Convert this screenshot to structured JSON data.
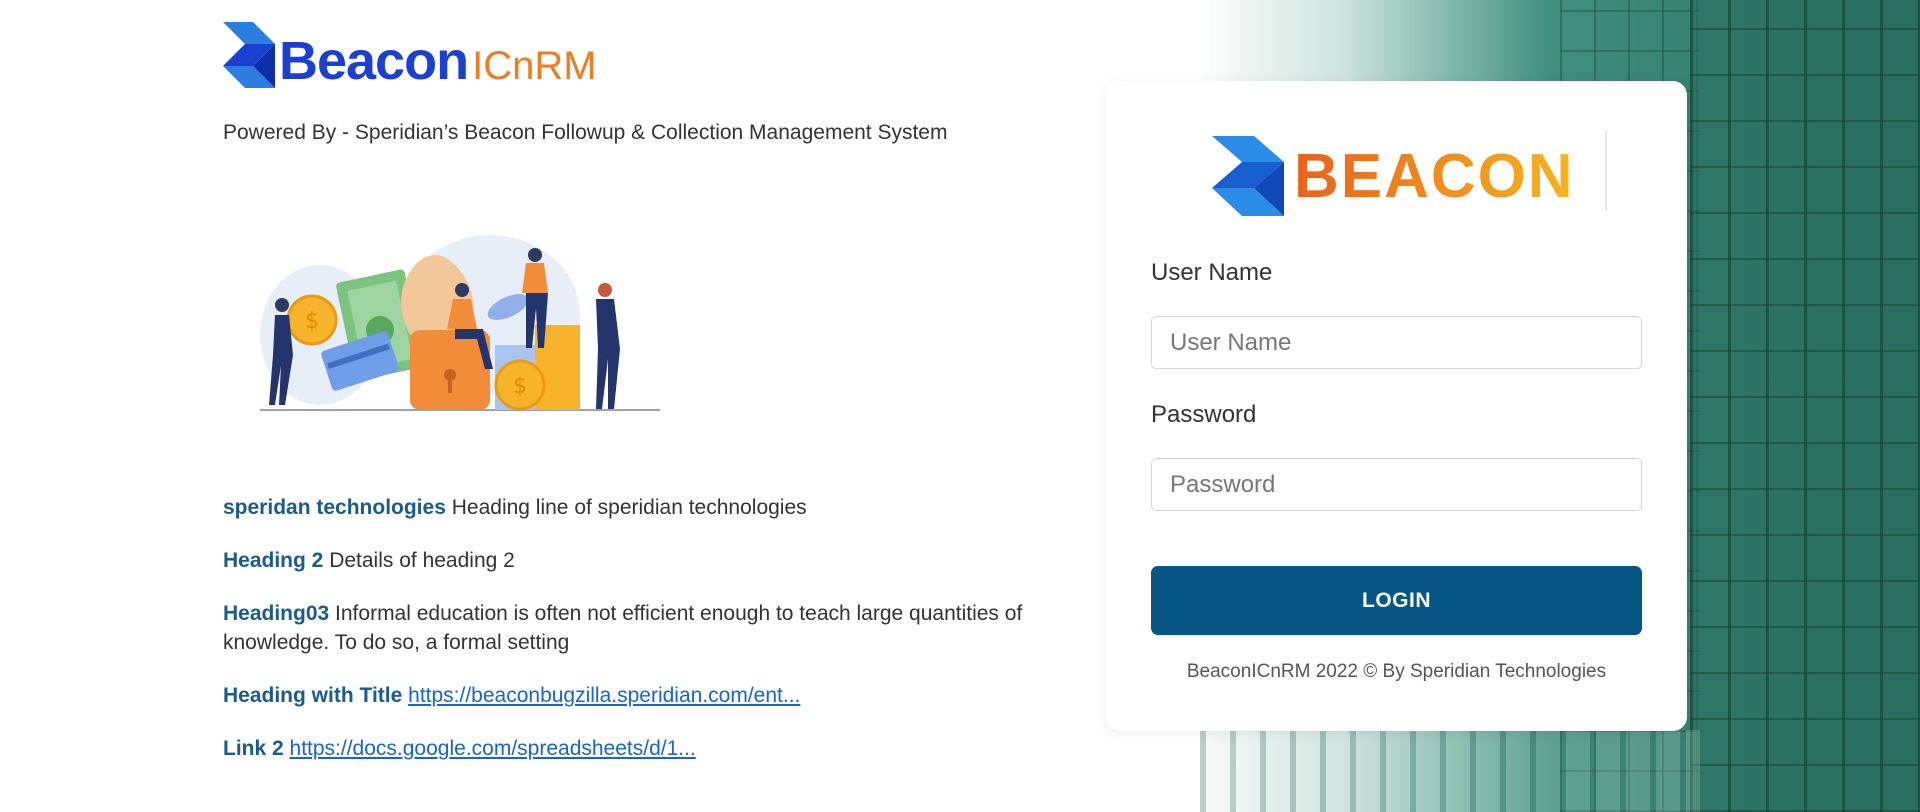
{
  "brand": {
    "name": "Beacon",
    "suffix": "ICnRM",
    "powered_by": "Powered By - Speridian’s Beacon Followup & Collection Management System"
  },
  "info": [
    {
      "heading": "speridan technologies",
      "text": "Heading line of speridian technologies"
    },
    {
      "heading": "Heading 2",
      "text": "Details of heading 2"
    },
    {
      "heading": "Heading03",
      "text": "Informal education is often not efficient enough to teach large quantities of knowledge. To do so, a formal setting"
    },
    {
      "heading": "Heading with Title",
      "link": "https://beaconbugzilla.speridian.com/ent..."
    },
    {
      "heading": "Link 2",
      "link": "https://docs.google.com/spreadsheets/d/1..."
    }
  ],
  "login": {
    "logo_text": "BEACON",
    "username_label": "User Name",
    "username_placeholder": "User Name",
    "password_label": "Password",
    "password_placeholder": "Password",
    "button": "LOGIN",
    "footer": "BeaconICnRM 2022 © By Speridian Technologies"
  },
  "colors": {
    "brand_blue": "#1a3fd1",
    "brand_orange": "#ee7d22",
    "button": "#075584",
    "heading": "#1a5a8c",
    "link": "#1a64c8"
  }
}
